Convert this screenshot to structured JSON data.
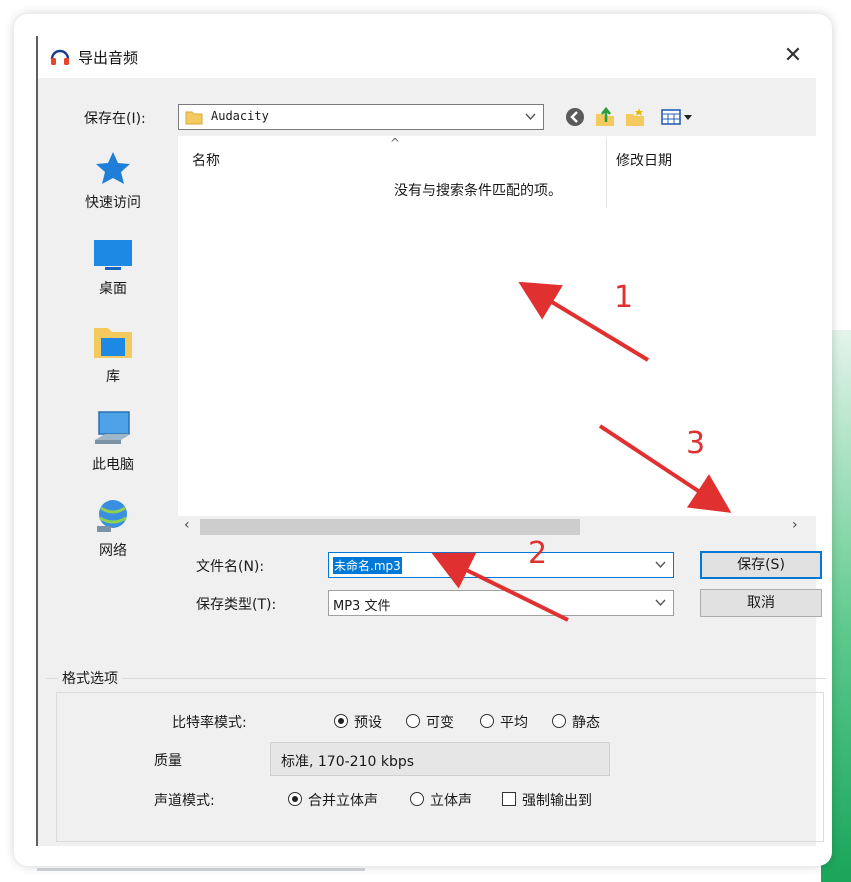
{
  "dialog": {
    "title": "导出音频",
    "close_glyph": "✕",
    "save_in_label": "保存在(I):",
    "save_in_value": "Audacity"
  },
  "toolbar_icons": [
    "back-icon",
    "up-folder-icon",
    "new-folder-icon",
    "view-menu-icon"
  ],
  "places": [
    {
      "label": "快速访问",
      "icon": "star-icon"
    },
    {
      "label": "桌面",
      "icon": "desktop-icon"
    },
    {
      "label": "库",
      "icon": "library-icon"
    },
    {
      "label": "此电脑",
      "icon": "computer-icon"
    },
    {
      "label": "网络",
      "icon": "network-icon"
    }
  ],
  "file_list": {
    "columns": [
      "名称",
      "修改日期"
    ],
    "empty_message": "没有与搜索条件匹配的项。"
  },
  "filename": {
    "label": "文件名(N):",
    "value": "未命名.mp3"
  },
  "filetype": {
    "label": "保存类型(T):",
    "value": "MP3 文件"
  },
  "buttons": {
    "save": "保存(S)",
    "cancel": "取消"
  },
  "format_options": {
    "title": "格式选项",
    "bitrate_mode_label": "比特率模式:",
    "bitrate_modes": [
      {
        "label": "预设",
        "selected": true
      },
      {
        "label": "可变",
        "selected": false
      },
      {
        "label": "平均",
        "selected": false
      },
      {
        "label": "静态",
        "selected": false
      }
    ],
    "quality_label": "质量",
    "quality_value": "标准, 170-210 kbps",
    "channel_mode_label": "声道模式:",
    "channel_modes": [
      {
        "label": "合并立体声",
        "selected": true
      },
      {
        "label": "立体声",
        "selected": false
      }
    ],
    "force_mono_label": "强制输出到",
    "force_mono_checked": false
  },
  "annotations": {
    "labels": [
      "1",
      "2",
      "3"
    ],
    "color": "#e03030"
  },
  "colors": {
    "accent": "#0078d7",
    "annotation": "#e03030",
    "green_edge": "#19a55a"
  }
}
